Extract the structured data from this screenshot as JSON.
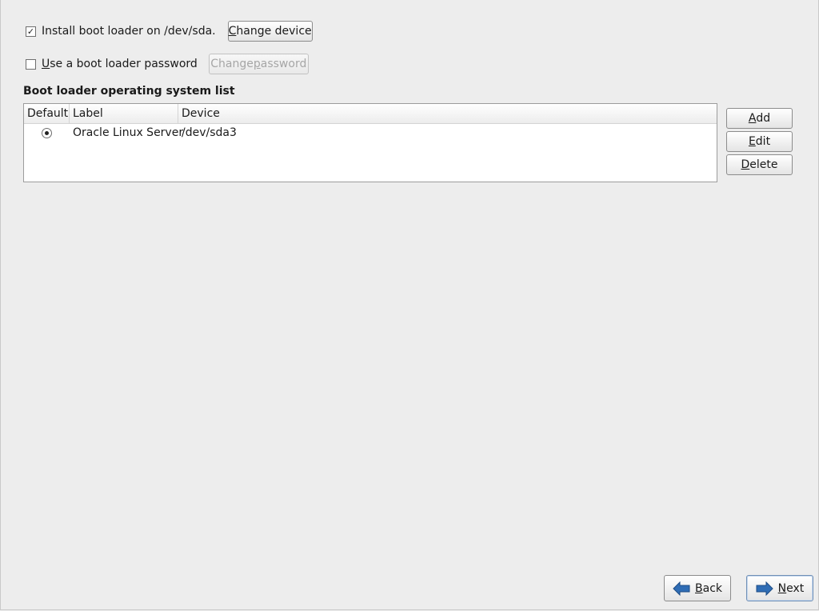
{
  "install_row": {
    "checked": true,
    "check_glyph": "✓",
    "label": "Install boot loader on /dev/sda.",
    "change_device_button": {
      "mnemonic": "C",
      "rest": "hange device"
    }
  },
  "password_row": {
    "checked": false,
    "label": "Use a boot loader password",
    "label_mnemonic": "U",
    "label_rest": "se a boot loader password",
    "change_password_button": {
      "pre": "Change ",
      "mnemonic": "p",
      "rest": "assword"
    }
  },
  "os_list": {
    "title": "Boot loader operating system list",
    "columns": [
      "Default",
      "Label",
      "Device"
    ],
    "rows": [
      {
        "default": true,
        "label": "Oracle Linux Server",
        "device": "/dev/sda3"
      }
    ]
  },
  "side_buttons": {
    "add": {
      "mnemonic": "A",
      "rest": "dd"
    },
    "edit": {
      "mnemonic": "E",
      "rest": "dit"
    },
    "delete": {
      "mnemonic": "D",
      "rest": "elete"
    }
  },
  "nav": {
    "back": {
      "mnemonic": "B",
      "rest": "ack"
    },
    "next": {
      "mnemonic": "N",
      "rest": "ext"
    }
  },
  "icons": {
    "back": "arrow-left-icon",
    "next": "arrow-right-icon"
  },
  "colors": {
    "background": "#ededed",
    "arrow_blue": "#2f6db5"
  }
}
